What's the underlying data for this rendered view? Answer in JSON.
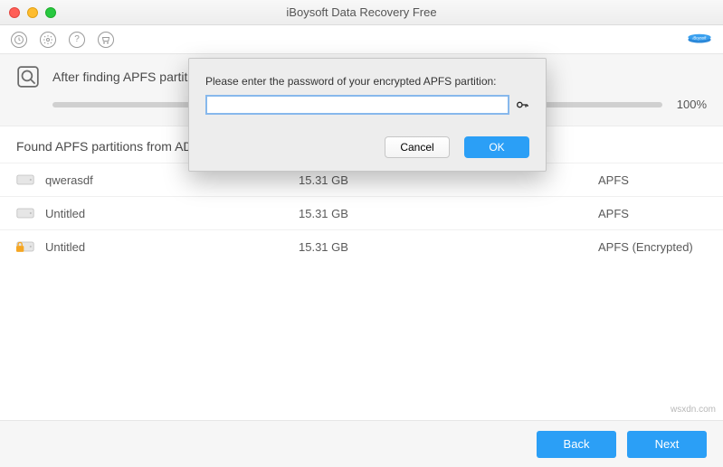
{
  "window": {
    "title": "iBoysoft Data Recovery Free"
  },
  "scan": {
    "status_text": "After finding APFS partitions",
    "percent_label": "100%"
  },
  "section_title": "Found APFS partitions from AD",
  "partitions": [
    {
      "name": "qwerasdf",
      "size": "15.31 GB",
      "fs": "APFS",
      "encrypted": false
    },
    {
      "name": "Untitled",
      "size": "15.31 GB",
      "fs": "APFS",
      "encrypted": false
    },
    {
      "name": "Untitled",
      "size": "15.31 GB",
      "fs": "APFS (Encrypted)",
      "encrypted": true
    }
  ],
  "footer": {
    "back": "Back",
    "next": "Next"
  },
  "modal": {
    "prompt": "Please enter the password of your encrypted APFS partition:",
    "value": "",
    "cancel": "Cancel",
    "ok": "OK"
  },
  "watermark": "wsxdn.com"
}
